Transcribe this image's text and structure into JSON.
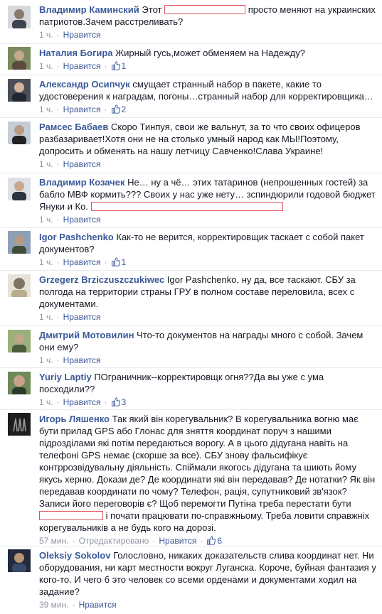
{
  "comments": [
    {
      "author": "Владимир Каминский",
      "text_a": "Этот",
      "text_b": "просто меняют на украинских патриотов.Зачем расстреливать?",
      "time": "1 ч.",
      "like": "Нравится",
      "likes": ""
    },
    {
      "author": "Наталия Богира",
      "text_a": "Жирный гусь,может обменяем на Надежду?",
      "text_b": "",
      "time": "1 ч.",
      "like": "Нравится",
      "likes": "1"
    },
    {
      "author": "Александр Осипчук",
      "text_a": "смущает странный набор в пакете, какие то удостоверения к наградам, погоны…странный набор для корректировщика…",
      "text_b": "",
      "time": "1 ч.",
      "like": "Нравится",
      "likes": "2"
    },
    {
      "author": "Рамсес Бабаев",
      "text_a": "Скоро Тинпуя, свои же вальнут, за то что своих офицеров разбазаривает!Хотя они не на столько умный народ как МЫ!Поэтому, допросить и обменять на нашу летчицу Савченко!Слава Украине!",
      "text_b": "",
      "time": "1 ч.",
      "like": "Нравится",
      "likes": ""
    },
    {
      "author": "Владимир Козачек",
      "text_a": "Не… ну а чё… этих татаринов (непрошенных гостей) за бабло МВФ кормить??? Своих у нас уже нету… зспиндюрили годовой бюджет Януки и Ко.",
      "text_b": "",
      "time": "1 ч.",
      "like": "Нравится",
      "likes": ""
    },
    {
      "author": "Igor Pashchenko",
      "text_a": "Как-то не верится, корректировщик таскает с собой пакет документов?",
      "text_b": "",
      "time": "1 ч.",
      "like": "Нравится",
      "likes": "1"
    },
    {
      "author": "Grzegerz Brziczuszczukiwec",
      "text_a": "Igor Pashchenko, ну да, все таскают. СБУ за полгода на территории страны ГРУ в полном составе переловила, всех с документами.",
      "text_b": "",
      "time": "1 ч.",
      "like": "Нравится",
      "likes": ""
    },
    {
      "author": "Дмитрий Мотовилин",
      "text_a": "Что-то документов на награды много с собой. Зачем они ему?",
      "text_b": "",
      "time": "1 ч.",
      "like": "Нравится",
      "likes": ""
    },
    {
      "author": "Yuriy Laptiy",
      "text_a": "ПОграничник--корректировщк огня??Да вы уже с ума посходили??",
      "text_b": "",
      "time": "1 ч.",
      "like": "Нравится",
      "likes": "3"
    },
    {
      "author": "Игорь Ляшенко",
      "text_a": "Так який він корегувальник? В корегувальника вогню має бути прилад GPS або Глонас для зняття координат поруч з нашими підрозділами які потім передаються ворогу. А в цього дідугана навіть на телефоні GPS немає (скорше за все). СБУ знову фальсифікує контррозвідувальну діяльність. Спіймали якогось дідугана та шиють йому якусь херню. Докази де? Де координати які він передавав? Де нотатки? Як він передавав координати по чому? Телефон, рація, супутниковий зв'язок? Записи його переговорів є? Щоб перемогти Путіна треба перестати бути",
      "text_b": "і почати працювати по-справжньому. Треба ловити справжніх корегувальників а не будь кого на дорозі.",
      "time": "57 мин.",
      "like": "Нравится",
      "extra": "Отредактировано",
      "likes": "6"
    },
    {
      "author": "Oleksiy Sokolov",
      "text_a": "Голословно, никаких доказательств слива координат нет. Ни оборудования, ни карт местности вокруг Луганска. Короче, буйная фантазия у кого-то. И чего б это человек со всеми орденами и документами ходил на задание?",
      "text_b": "",
      "time": "39 мин.",
      "like": "Нравится",
      "likes": ""
    }
  ],
  "colors": {
    "link": "#3b5998",
    "meta": "#9197a3",
    "text": "#141823",
    "redact": "#e0565b"
  }
}
